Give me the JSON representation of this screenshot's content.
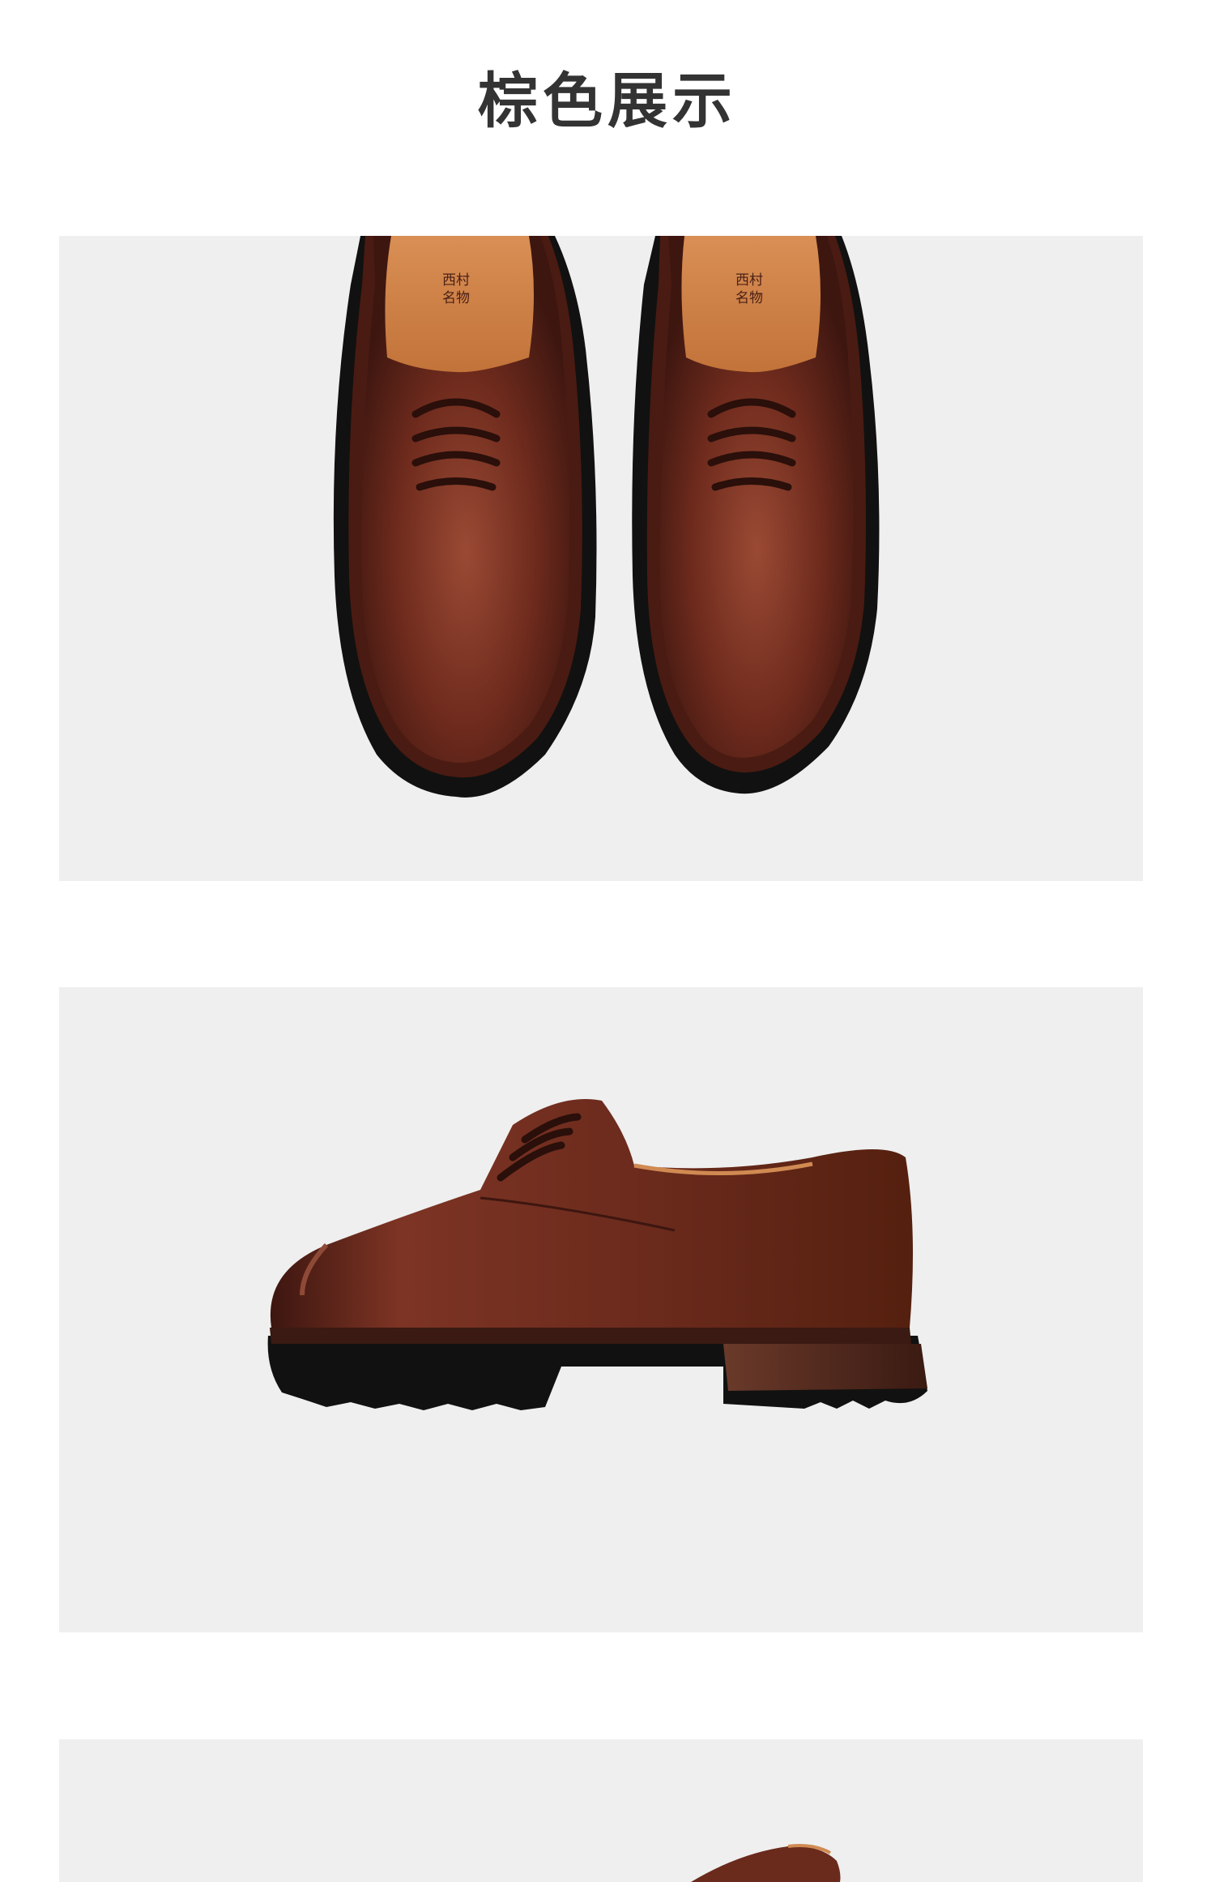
{
  "page": {
    "title": "棕色展示"
  },
  "photos": [
    {
      "subject": "brown-derby-shoes-top-view",
      "insole_logo": [
        "西村",
        "名物"
      ]
    },
    {
      "subject": "brown-derby-shoe-side-view"
    },
    {
      "subject": "brown-derby-shoe-partial-view"
    }
  ],
  "colors": {
    "panel_background": "#efefef",
    "leather_brown": "#6b2a1c",
    "sole_black": "#111111",
    "title_text": "#333333"
  }
}
